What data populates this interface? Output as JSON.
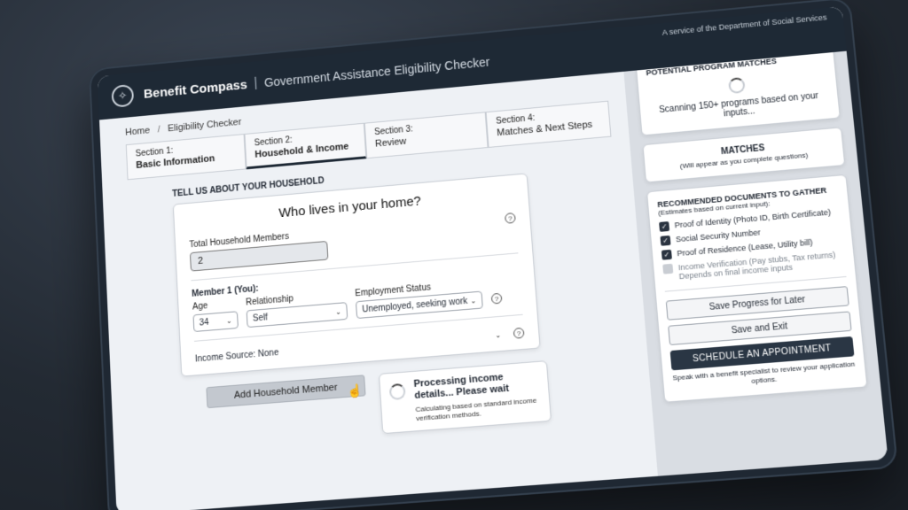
{
  "header": {
    "brand": "Benefit Compass",
    "separator": "|",
    "subtitle": "Government Assistance Eligibility Checker",
    "agency": "A service of the Department of Social Services"
  },
  "breadcrumb": {
    "home": "Home",
    "separator": "/",
    "current": "Eligibility Checker"
  },
  "steps": [
    {
      "num": "Section 1:",
      "label": "Basic Information"
    },
    {
      "num": "Section 2:",
      "label": "Household & Income"
    },
    {
      "num": "Section 3:",
      "label": "Review"
    },
    {
      "num": "Section 4:",
      "label": "Matches & Next Steps"
    }
  ],
  "household": {
    "section_label": "TELL US ABOUT YOUR HOUSEHOLD",
    "title": "Who lives in your home?",
    "total_label": "Total Household Members",
    "total_value": "2",
    "member_title": "Member 1 (You):",
    "age_label": "Age",
    "age_value": "34",
    "relationship_label": "Relationship",
    "relationship_value": "Self",
    "employment_label": "Employment Status",
    "employment_value": "Unemployed, seeking work",
    "income_label": "Income Source:",
    "income_value": "None",
    "help": "?"
  },
  "actions": {
    "add_member": "Add Household Member"
  },
  "processing": {
    "title": "Processing income details... Please wait",
    "note": "Calculating based on standard income verification methods."
  },
  "sidebar": {
    "potential_title": "POTENTIAL PROGRAM MATCHES",
    "scanning": "Scanning 150+ programs based on your inputs...",
    "matches_title": "MATCHES",
    "matches_sub": "(Will appear as you complete questions)",
    "docs_title": "RECOMMENDED DOCUMENTS TO GATHER",
    "docs_sub": "(Estimates based on current input):",
    "docs": [
      {
        "label": "Proof of Identity (Photo ID, Birth Certificate)",
        "checked": true
      },
      {
        "label": "Social Security Number",
        "checked": true
      },
      {
        "label": "Proof of Residence (Lease, Utility bill)",
        "checked": true
      },
      {
        "label": "Income Verification (Pay stubs, Tax returns) Depends on final income inputs",
        "checked": false
      }
    ],
    "save_progress": "Save Progress for Later",
    "save_exit": "Save and Exit",
    "schedule": "SCHEDULE AN APPOINTMENT",
    "schedule_note": "Speak with a benefit specialist to review your application options."
  },
  "icons": {
    "compass": "✧",
    "check": "✓",
    "chevron": "⌄",
    "cursor": "☝"
  }
}
